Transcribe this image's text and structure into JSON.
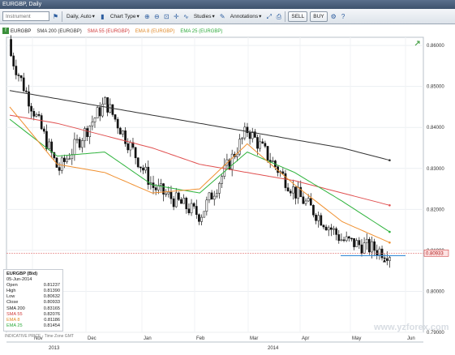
{
  "window": {
    "title": "EURGBP, Daily"
  },
  "toolbar": {
    "instrument_placeholder": "Instrument",
    "period": "Daily, Auto",
    "chart_type": "Chart Type",
    "studies": "Studies",
    "annotations": "Annotations",
    "sell": "SELL",
    "buy": "BUY"
  },
  "legend": {
    "symbol": "EURGBP",
    "sma200": "SMA 200 (EURGBP)",
    "sma55": "SMA 55 (EURGBP)",
    "ema8": "EMA 8 (EURGBP)",
    "ema25": "EMA 25 (EURGBP)"
  },
  "info": {
    "title": "EURGBP (Bid)",
    "date": "05-Jun-2014",
    "rows": [
      {
        "label": "Open",
        "value": "0.81237",
        "color": "#222222"
      },
      {
        "label": "High",
        "value": "0.81390",
        "color": "#222222"
      },
      {
        "label": "Low",
        "value": "0.80632",
        "color": "#222222"
      },
      {
        "label": "Close",
        "value": "0.80933",
        "color": "#222222"
      },
      {
        "label": "SMA 200",
        "value": "0.83165",
        "color": "#222222"
      },
      {
        "label": "SMA 55",
        "value": "0.82076",
        "color": "#d03b3b"
      },
      {
        "label": "EMA 8",
        "value": "0.81186",
        "color": "#e08a2a"
      },
      {
        "label": "EMA 25",
        "value": "0.81454",
        "color": "#2eaa3c"
      }
    ]
  },
  "indicative_label": "INDICATIVE PRICE - Time Zone GMT",
  "watermark": "www.yzforex.com",
  "current_price_label": "0.80933",
  "colors": {
    "sma200": "#333333",
    "sma55": "#e05050",
    "ema8": "#f09030",
    "ema25": "#2eb33c",
    "support": "#3a8fd8",
    "price_line": "#e07070"
  },
  "chart_data": {
    "type": "candlestick",
    "y_ticks": [
      "0.86000",
      "0.85000",
      "0.84000",
      "0.83000",
      "0.82000",
      "0.81000",
      "0.80000",
      "0.79000"
    ],
    "ylim": [
      0.79,
      0.862
    ],
    "x_months": [
      "Nov",
      "Dec",
      "Jan",
      "Feb",
      "Mar",
      "Apr",
      "May",
      "Jun"
    ],
    "x_years": [
      "2013",
      "2014"
    ],
    "support_level": 0.8087,
    "sma200": [
      0.849,
      0.847,
      0.845,
      0.843,
      0.841,
      0.839,
      0.837,
      0.835,
      0.832
    ],
    "sma55": [
      0.843,
      0.841,
      0.838,
      0.835,
      0.831,
      0.829,
      0.827,
      0.824,
      0.821
    ],
    "ema25": [
      0.842,
      0.833,
      0.834,
      0.826,
      0.824,
      0.834,
      0.829,
      0.822,
      0.8145
    ],
    "ema8": [
      0.845,
      0.831,
      0.829,
      0.824,
      0.825,
      0.836,
      0.826,
      0.817,
      0.8119
    ],
    "close_anchors": [
      0.8575,
      0.8295,
      0.8462,
      0.8255,
      0.8185,
      0.8395,
      0.8242,
      0.8125,
      0.8093
    ]
  }
}
